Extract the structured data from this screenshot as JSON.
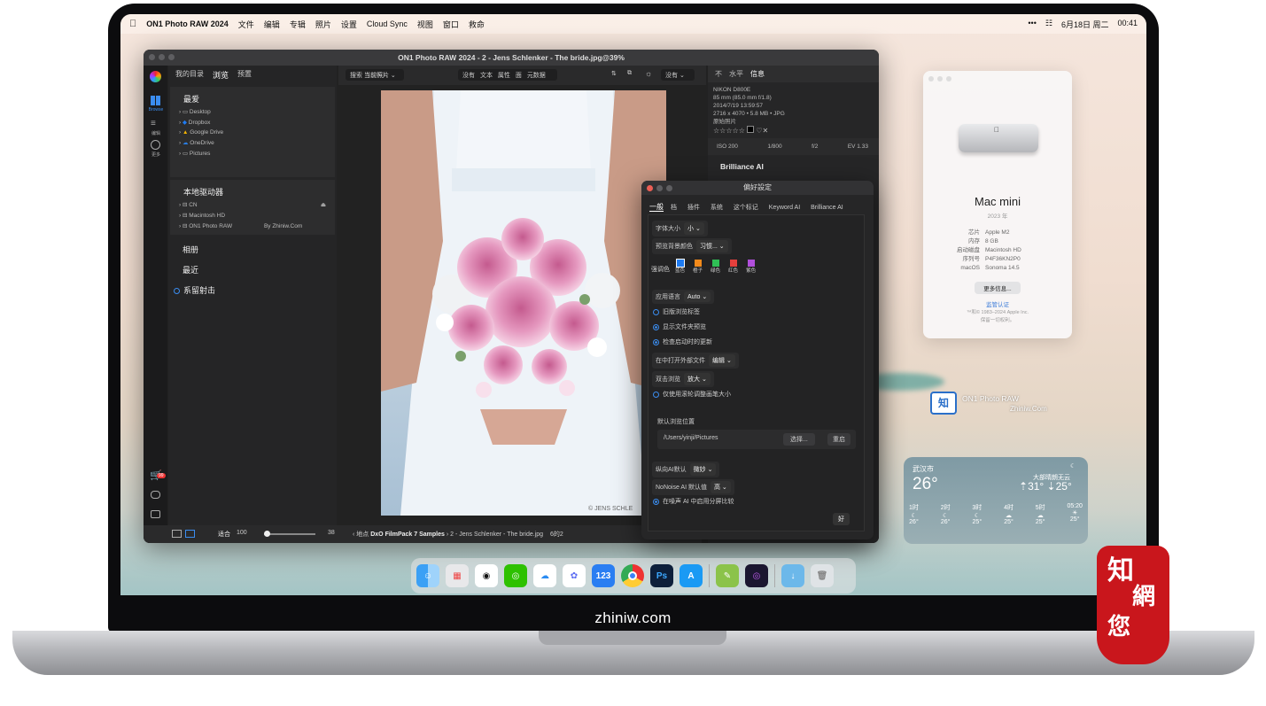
{
  "menubar": {
    "app": "ON1 Photo RAW 2024",
    "items": [
      "文件",
      "编辑",
      "专辑",
      "照片",
      "设置",
      "Cloud Sync",
      "视图",
      "窗口",
      "救命"
    ],
    "date": "6月18日 周二",
    "time": "00:41",
    "more": "•••"
  },
  "app": {
    "title": "ON1 Photo RAW 2024 - 2 - Jens Schlenker - The bride.jpg@39%",
    "sidebar": {
      "tabs": [
        "我的目录",
        "浏览",
        "预置"
      ],
      "favorites_header": "最爱",
      "favorites": [
        "Desktop",
        "Dropbox",
        "Google Drive",
        "OneDrive",
        "Pictures"
      ],
      "drives_header": "本地驱动器",
      "drives": [
        "CN",
        "Macintosh HD",
        "ON1 Photo RAW"
      ],
      "drive_watermark": "By Zhiniw.Com",
      "albums": "相册",
      "recent": "最近",
      "tethered": "系留射击"
    },
    "tools": {
      "browse": "Browse",
      "edit": "编辑",
      "more": "更多",
      "cart_badge": "99"
    },
    "viewer_top": {
      "search": "搜索",
      "scope": "当前照片",
      "none": "没有",
      "text": "文本",
      "attrs": "属性",
      "face": "面",
      "meta": "元数据",
      "compare": "没有"
    },
    "bottom": {
      "fit": "适合",
      "zoom": "100",
      "slider_value": "38",
      "location_label": "地点",
      "folder": "DxO FilmPack 7 Samples",
      "file": "2 - Jens Schlenker - The bride.jpg",
      "count": "6的2",
      "photo_credit": "© JENS SCHLE"
    },
    "info": {
      "tabs": [
        "不",
        "水平",
        "信息"
      ],
      "camera": "NIKON D800E",
      "lens": "85 mm (85.0 mm f/1.8)",
      "date": "2014/7/19 13:59:57",
      "size": "2716 x 4070 • 5.8 MB • JPG",
      "raw": "原始照片",
      "iso": "ISO 200",
      "shutter": "1/800",
      "aperture": "f/2",
      "ev": "EV 1.33",
      "brilliance": "Brilliance AI"
    }
  },
  "prefs": {
    "title": "偏好設定",
    "tabs": [
      "一般",
      "档",
      "插件",
      "系统",
      "这个标记",
      "Keyword AI",
      "Brilliance AI"
    ],
    "font_size_label": "字体大小",
    "font_size": "小",
    "bg_label": "预览背景颜色",
    "bg": "习惯...",
    "accent_label": "强调色",
    "accents": [
      {
        "name": "蓝色",
        "color": "#1e7bf2"
      },
      {
        "name": "橙子",
        "color": "#f38a1b"
      },
      {
        "name": "绿色",
        "color": "#2fbf55"
      },
      {
        "name": "红色",
        "color": "#e6403d"
      },
      {
        "name": "紫色",
        "color": "#b14fdc"
      }
    ],
    "lang_label": "应用语言",
    "lang": "Auto",
    "opt1": "旧版浏览标签",
    "opt2": "显示文件夹预览",
    "opt3": "检查启动时的更新",
    "open_ext_label": "在中打开外部文件",
    "open_ext": "编辑",
    "dbl_label": "双击浏览",
    "dbl": "放大",
    "opt4": "仅使用滚轮调整画笔大小",
    "default_loc_label": "默认浏览位置",
    "default_loc": "/Users/yinji/Pictures",
    "choose": "选择...",
    "reset": "重启",
    "portrait_label": "纵向AI默认",
    "portrait": "微妙",
    "nonoise_label": "NoNoise AI 默认值",
    "nonoise": "高",
    "opt5": "在噪声 AI 中启用分屏比较",
    "ok": "好"
  },
  "about": {
    "name": "Mac mini",
    "year": "2023 年",
    "rows": [
      {
        "k": "芯片",
        "v": "Apple M2"
      },
      {
        "k": "内存",
        "v": "8 GB"
      },
      {
        "k": "启动磁盘",
        "v": "Macintosh HD"
      },
      {
        "k": "序列号",
        "v": "P4F36KN2P0"
      },
      {
        "k": "macOS",
        "v": "Sonoma 14.5"
      }
    ],
    "more": "更多信息...",
    "reg": "监管认证",
    "copy1": "™和© 1983–2024 Apple Inc.",
    "copy2": "保留一切权利。"
  },
  "desktop_icon": {
    "label": "ON1 Photo RAW",
    "sub": "Zhiniw.Com"
  },
  "weather": {
    "city": "武汉市",
    "temp": "26°",
    "cond": "大部晴朗无云",
    "hi": "31°",
    "lo": "25°",
    "hours": [
      {
        "t": "1时",
        "v": "26°"
      },
      {
        "t": "2时",
        "v": "26°"
      },
      {
        "t": "3时",
        "v": "25°"
      },
      {
        "t": "4时",
        "v": "25°"
      },
      {
        "t": "5时",
        "v": "25°"
      },
      {
        "t": "05:20",
        "v": "25°"
      }
    ]
  },
  "dock": {
    "apps": [
      "finder",
      "launchpad",
      "qq",
      "wechat",
      "baidu-cloud",
      "aliyun",
      "123",
      "chrome",
      "Ps",
      "App Store",
      "notes",
      "on1",
      "folder",
      "trash"
    ],
    "label_123": "123",
    "label_ps": "Ps"
  },
  "site": "zhiniw.com",
  "stamp": {
    "line1": "知",
    "line2": "網",
    "line3": "您"
  },
  "colors": {
    "accent": "#3b8df0",
    "stamp": "#c9161c"
  }
}
